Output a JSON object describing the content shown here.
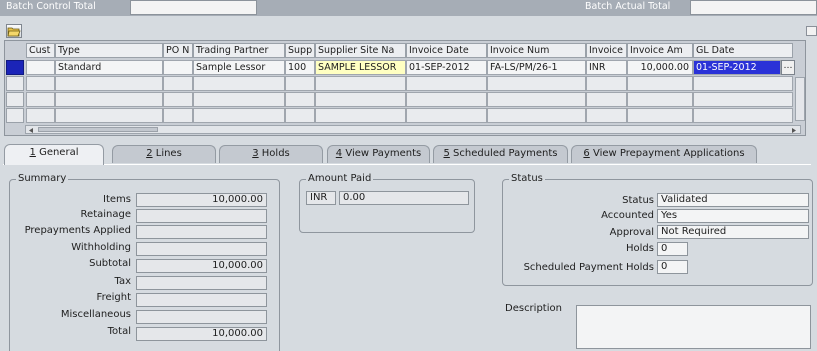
{
  "batch": {
    "control_total_label": "Batch Control Total",
    "actual_total_label": "Batch Actual Total"
  },
  "grid": {
    "columns": [
      "Cust",
      "Type",
      "PO N",
      "Trading Partner",
      "Supp",
      "Supplier Site Na",
      "Invoice Date",
      "Invoice Num",
      "Invoice",
      "Invoice Am",
      "GL Date"
    ],
    "row": {
      "type": "Standard",
      "trading_partner": "Sample Lessor",
      "supplier_num": "100",
      "supplier_site": "SAMPLE LESSOR",
      "invoice_date": "01-SEP-2012",
      "invoice_num": "FA-LS/PM/26-1",
      "currency": "INR",
      "invoice_amount": "10,000.00",
      "gl_date": "01-SEP-2012"
    },
    "lov_glyph": "…"
  },
  "tabs": [
    {
      "num": "1",
      "label": " General"
    },
    {
      "num": "2",
      "label": " Lines"
    },
    {
      "num": "3",
      "label": " Holds"
    },
    {
      "num": "4",
      "label": " View Payments"
    },
    {
      "num": "5",
      "label": " Scheduled Payments"
    },
    {
      "num": "6",
      "label": " View Prepayment Applications"
    }
  ],
  "summary": {
    "title": "Summary",
    "items_label": "Items",
    "items_value": "10,000.00",
    "retainage_label": "Retainage",
    "prepayments_label": "Prepayments Applied",
    "withholding_label": "Withholding",
    "subtotal_label": "Subtotal",
    "subtotal_value": "10,000.00",
    "tax_label": "Tax",
    "freight_label": "Freight",
    "misc_label": "Miscellaneous",
    "total_label": "Total",
    "total_value": "10,000.00"
  },
  "amount_paid": {
    "title": "Amount Paid",
    "currency": "INR",
    "value": "0.00"
  },
  "status": {
    "title": "Status",
    "status_label": "Status",
    "status_value": "Validated",
    "accounted_label": "Accounted",
    "accounted_value": "Yes",
    "approval_label": "Approval",
    "approval_value": "Not Required",
    "holds_label": "Holds",
    "holds_value": "0",
    "sched_holds_label": "Scheduled Payment Holds",
    "sched_holds_value": "0"
  },
  "description": {
    "label": "Description"
  }
}
